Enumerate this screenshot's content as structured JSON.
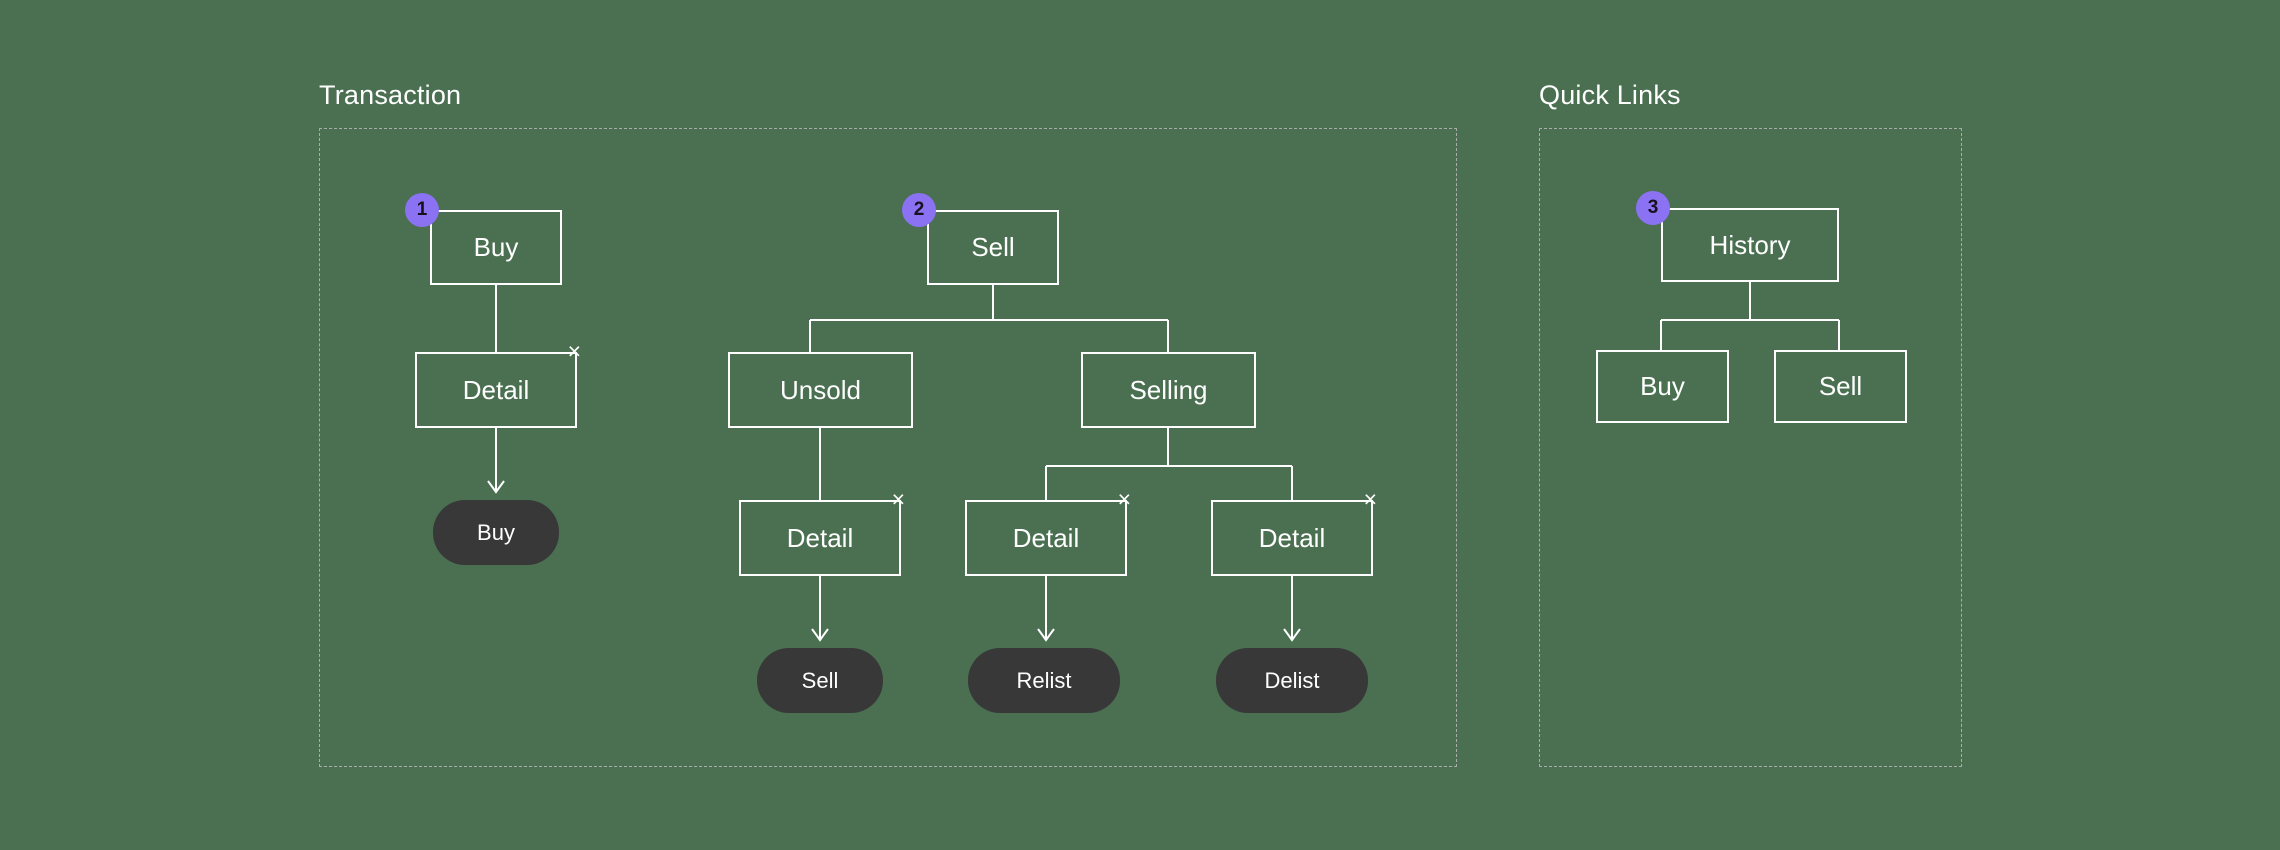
{
  "canvas": {
    "background_color": "#4a7051",
    "node_border_color": "#ffffff",
    "node_text_color": "#ffffff",
    "pill_color": "#383838",
    "badge_color": "#8b72f2",
    "panel_border_color": "#a9aeab",
    "connector_color": "#ffffff"
  },
  "sections": [
    {
      "id": "transaction",
      "label": "Transaction"
    },
    {
      "id": "quick_links",
      "label": "Quick Links"
    }
  ],
  "badges": [
    {
      "id": "badge_1",
      "text": "1",
      "attached_to": "buy_root"
    },
    {
      "id": "badge_2",
      "text": "2",
      "attached_to": "sell_root"
    },
    {
      "id": "badge_3",
      "text": "3",
      "attached_to": "history_root"
    }
  ],
  "close_icon": "×",
  "transaction": {
    "buy_flow": {
      "root": {
        "id": "buy_root",
        "label": "Buy",
        "type": "screen"
      },
      "detail": {
        "id": "buy_detail",
        "label": "Detail",
        "type": "screen",
        "closable": true
      },
      "action": {
        "id": "buy_action",
        "label": "Buy",
        "type": "action"
      }
    },
    "sell_flow": {
      "root": {
        "id": "sell_root",
        "label": "Sell",
        "type": "screen"
      },
      "unsold": {
        "id": "unsold",
        "label": "Unsold",
        "type": "screen"
      },
      "selling": {
        "id": "selling",
        "label": "Selling",
        "type": "screen"
      },
      "unsold_detail": {
        "id": "unsold_detail",
        "label": "Detail",
        "type": "screen",
        "closable": true
      },
      "unsold_action": {
        "id": "unsold_action",
        "label": "Sell",
        "type": "action"
      },
      "selling_detail_left": {
        "id": "selling_detail_left",
        "label": "Detail",
        "type": "screen",
        "closable": true
      },
      "selling_action_left": {
        "id": "selling_action_left",
        "label": "Relist",
        "type": "action"
      },
      "selling_detail_right": {
        "id": "selling_detail_right",
        "label": "Detail",
        "type": "screen",
        "closable": true
      },
      "selling_action_right": {
        "id": "selling_action_right",
        "label": "Delist",
        "type": "action"
      }
    }
  },
  "quick_links": {
    "root": {
      "id": "history_root",
      "label": "History",
      "type": "screen"
    },
    "children": [
      {
        "id": "history_buy",
        "label": "Buy",
        "type": "screen"
      },
      {
        "id": "history_sell",
        "label": "Sell",
        "type": "screen"
      }
    ]
  }
}
